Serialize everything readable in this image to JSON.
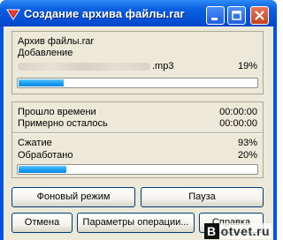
{
  "window": {
    "title": "Создание архива файлы.rar",
    "accent_color": "#0054e3",
    "controls": [
      "minimize-icon",
      "maximize-icon",
      "close-icon"
    ]
  },
  "archive": {
    "archive_label": "Архив файлы.rar",
    "action_label": "Добавление",
    "file_suffix": ".mp3",
    "file_percent_text": "19%",
    "file_progress": 0.19
  },
  "stats": {
    "elapsed_label": "Прошло времени",
    "elapsed_value": "00:00:00",
    "remaining_label": "Примерно осталось",
    "remaining_value": "00:00:00",
    "compression_label": "Сжатие",
    "compression_value": "93%",
    "processed_label": "Обработано",
    "processed_value": "20%",
    "processed_progress": 0.2
  },
  "buttons": {
    "background": "Фоновый режим",
    "pause": "Пауза",
    "cancel": "Отмена",
    "options": "Параметры операции...",
    "help": "Справка"
  },
  "watermark": {
    "first_letter": "B",
    "rest": "otvet.ru"
  }
}
